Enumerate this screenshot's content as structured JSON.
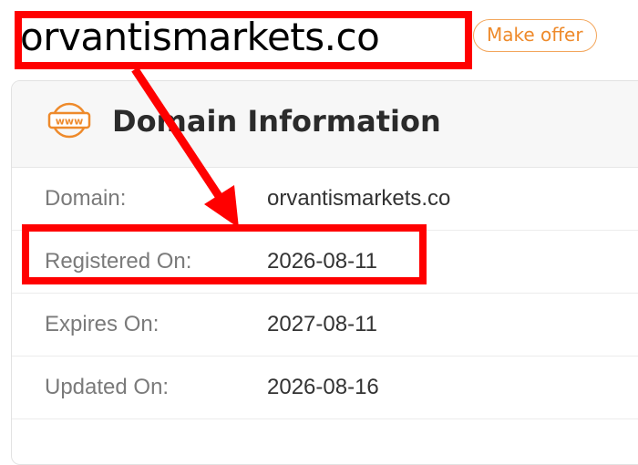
{
  "header": {
    "domain": "orvantismarkets.co",
    "offer_button": "Make offer"
  },
  "card": {
    "icon": "www-globe-icon",
    "icon_text": "www",
    "title": "Domain Information",
    "rows": [
      {
        "label": "Domain:",
        "value": "orvantismarkets.co"
      },
      {
        "label": "Registered On:",
        "value": "2026-08-11"
      },
      {
        "label": "Expires On:",
        "value": "2027-08-11"
      },
      {
        "label": "Updated On:",
        "value": "2026-08-16"
      }
    ]
  },
  "colors": {
    "accent": "#ee8a2b",
    "annotation": "#ff0000"
  }
}
